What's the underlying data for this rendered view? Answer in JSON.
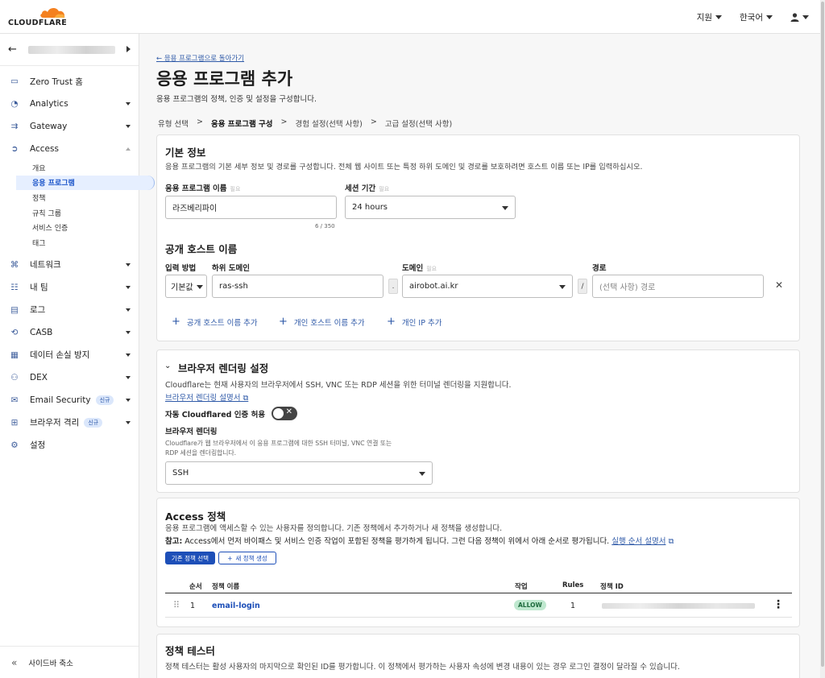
{
  "header": {
    "logo_text": "CLOUDFLARE",
    "support_label": "지원",
    "language_label": "한국어",
    "user_icon": "user-icon"
  },
  "sidebar": {
    "account_name": "",
    "items": [
      {
        "label": "Zero Trust 홈",
        "icon": "home-icon"
      },
      {
        "label": "Analytics",
        "icon": "analytics-icon"
      },
      {
        "label": "Gateway",
        "icon": "gateway-icon"
      },
      {
        "label": "Access",
        "icon": "access-icon"
      },
      {
        "label": "네트워크",
        "icon": "network-icon"
      },
      {
        "label": "내 팀",
        "icon": "team-icon"
      },
      {
        "label": "로그",
        "icon": "logs-icon"
      },
      {
        "label": "CASB",
        "icon": "casb-icon"
      },
      {
        "label": "데이터 손실 방지",
        "icon": "dlp-icon"
      },
      {
        "label": "DEX",
        "icon": "dex-icon"
      },
      {
        "label": "Email Security",
        "icon": "email-icon",
        "badge": "신규"
      },
      {
        "label": "브라우저 격리",
        "icon": "browser-icon",
        "badge": "신규"
      },
      {
        "label": "설정",
        "icon": "settings-icon"
      }
    ],
    "access_sub": [
      "개요",
      "응용 프로그램",
      "정책",
      "규칙 그룹",
      "서비스 인증",
      "태그"
    ],
    "collapse_label": "사이드바 축소"
  },
  "main": {
    "back_link": "← 응용 프로그램으로 돌아가기",
    "title": "응용 프로그램 추가",
    "description": "응용 프로그램의 정책, 인증 및 설정을 구성합니다.",
    "steps": [
      "유형 선택",
      ">",
      "응용 프로그램 구성",
      ">",
      "경험 설정(선택 사항)",
      ">",
      "고급 설정(선택 사항)"
    ],
    "basic": {
      "title": "기본 정보",
      "desc": "응용 프로그램의 기본 세부 정보 및 경로를 구성합니다. 전체 웹 사이트 또는 특정 하위 도메인 및 경로를 보호하려면 호스트 이름 또는 IP를 입력하십시오.",
      "app_name_label": "응용 프로그램 이름",
      "required": "필요",
      "app_name_value": "라즈베리파이",
      "char_count": "6 / 350",
      "session_label": "세션 기간",
      "session_value": "24 hours",
      "public_host_title": "공개 호스트 이름",
      "input_method_label": "입력 방법",
      "input_method_value": "기본값",
      "subdomain_label": "하위 도메인",
      "subdomain_value": "ras-ssh",
      "dot": ".",
      "domain_label": "도메인",
      "domain_value": "airobot.ai.kr",
      "slash": "/",
      "path_label": "경로",
      "path_placeholder": "(선택 사항) 경로",
      "remove": "✕",
      "add_public": "공개 호스트 이름 추가",
      "add_private": "개인 호스트 이름 추가",
      "add_ip": "개인 IP 추가",
      "plus": "+"
    },
    "browser": {
      "title": "브라우저 렌더링 설정",
      "desc": "Cloudflare는 현재 사용자의 브라우저에서 SSH, VNC 또는 RDP 세션을 위한 터미널 렌더링을 지원합니다.",
      "doc_link": "브라우저 렌더링 설명서",
      "auto_label": "자동 Cloudflared 인증 허용",
      "toggle_x": "✕",
      "render_label": "브라우저 렌더링",
      "render_desc1": "Cloudflare가 웹 브라우저에서 이 응용 프로그램에 대한 SSH 터미널, VNC 연결 또는",
      "render_desc2": "RDP 세션을 렌더링합니다.",
      "render_value": "SSH"
    },
    "policy": {
      "title": "Access 정책",
      "desc": "응용 프로그램에 액세스할 수 있는 사용자를 정의합니다. 기존 정책에서 추가하거나 새 정책을 생성합니다.",
      "note_bold": "참고:",
      "note": " Access에서 먼저 바이패스 및 서비스 인증 작업이 포함된 정책을 평가하게 됩니다. 그런 다음 정책이 위에서 아래 순서로 평가됩니다. ",
      "note_link": "실행 순서 설명서",
      "btn_existing": "기존 정책 선택",
      "btn_new": "새 정책 생성",
      "cols": {
        "order": "순서",
        "name": "정책 이름",
        "action": "작업",
        "rules": "Rules",
        "id": "정책 ID"
      },
      "rows": [
        {
          "order": "1",
          "name": "email-login",
          "action": "ALLOW",
          "rules": "1"
        }
      ]
    },
    "tester": {
      "title": "정책 테스터",
      "desc": "정책 테스터는 활성 사용자의 마지막으로 확인된 ID를 평가합니다. 이 정책에서 평가하는 사용자 속성에 변경 내용이 있는 경우 로그인 결정이 달라질 수 있습니다."
    }
  },
  "colors": {
    "accent": "#1d4fb8",
    "link": "#2f5aa8",
    "allow_bg": "#bfe8cf",
    "brand_orange": "#f48120"
  }
}
